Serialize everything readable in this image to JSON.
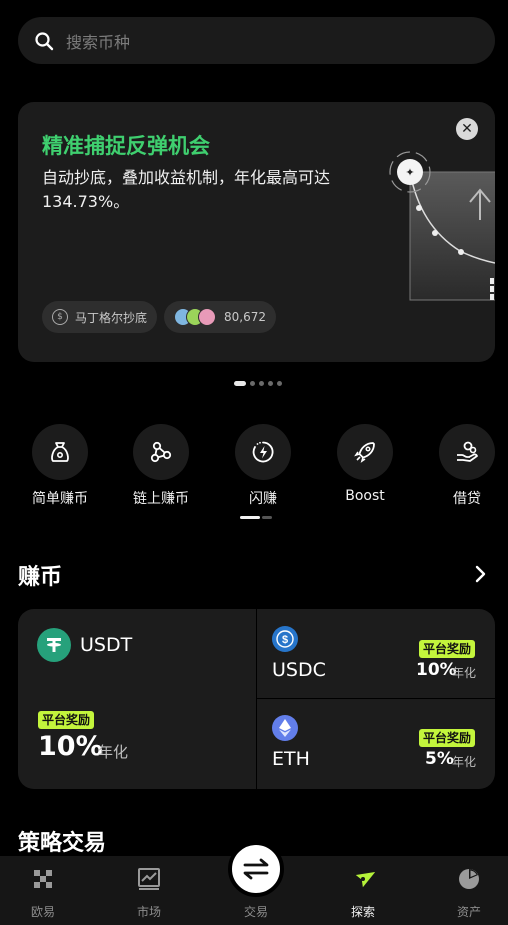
{
  "search": {
    "placeholder": "搜索币种"
  },
  "banner": {
    "title": "精准捕捉反弹机会",
    "description": "自动抄底，叠加收益机制，年化最高可达134.73%。",
    "tag_label": "马丁格尔抄底",
    "participants": "80,672",
    "colors": {
      "title": "#3fcf6f"
    }
  },
  "carousel": {
    "total": 5,
    "active": 0
  },
  "quick_actions": [
    {
      "label": "简单赚币",
      "icon": "money-bag-icon"
    },
    {
      "label": "链上赚币",
      "icon": "chain-nodes-icon"
    },
    {
      "label": "闪赚",
      "icon": "flash-timer-icon"
    },
    {
      "label": "Boost",
      "icon": "rocket-icon"
    },
    {
      "label": "借贷",
      "icon": "hand-coin-icon"
    }
  ],
  "earn_section": {
    "title": "赚币",
    "usdt": {
      "name": "USDT",
      "badge": "平台奖励",
      "rate": "10%",
      "unit": "年化"
    },
    "usdc": {
      "name": "USDC",
      "badge": "平台奖励",
      "rate": "10%",
      "unit": "年化"
    },
    "eth": {
      "name": "ETH",
      "badge": "平台奖励",
      "rate": "5%",
      "unit": "年化"
    },
    "colors": {
      "badge": "#c3f53c",
      "usdt": "#26a17b",
      "usdc": "#2775ca",
      "eth": "#627eea"
    }
  },
  "strategy_section": {
    "title": "策略交易"
  },
  "tabbar": {
    "items": [
      {
        "label": "欧易",
        "icon": "exchange-logo-icon"
      },
      {
        "label": "市场",
        "icon": "chart-icon"
      },
      {
        "label": "交易",
        "icon": "swap-icon"
      },
      {
        "label": "探索",
        "icon": "compass-icon"
      },
      {
        "label": "资产",
        "icon": "pie-chart-icon"
      }
    ],
    "active": 3
  }
}
